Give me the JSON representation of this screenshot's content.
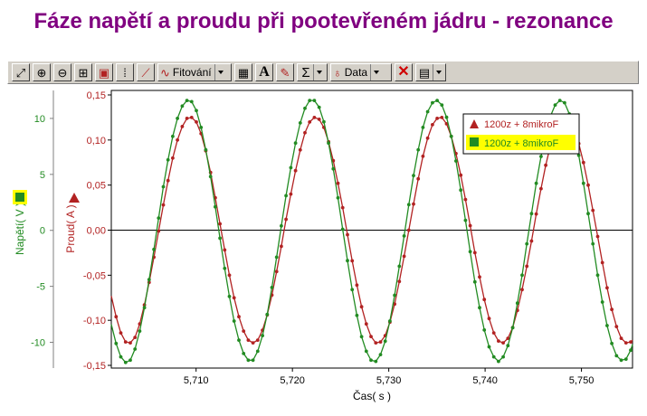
{
  "title": "Fáze napětí a proudu při pootevřeném jádru - rezonance",
  "toolbar": {
    "fit_label": "Fitování",
    "sigma_label": "Σ",
    "data_label": "Data",
    "text_tool_label": "A"
  },
  "colors": {
    "voltage": "#228b22",
    "current": "#b22222",
    "title": "#800080",
    "highlight": "#ffff00"
  },
  "chart_data": {
    "type": "line",
    "xlabel": "Čas( s )",
    "xlim": [
      5.7012,
      5.7553
    ],
    "xticks": [
      5.71,
      5.72,
      5.73,
      5.74,
      5.75
    ],
    "xtick_labels": [
      "5,710",
      "5,720",
      "5,730",
      "5,740",
      "5,750"
    ],
    "y_left": {
      "label": "Napětí( V )",
      "lim": [
        -12.3,
        12.5
      ],
      "ticks": [
        10,
        5,
        0,
        -5,
        -10
      ],
      "tick_labels": [
        "10",
        "5",
        "0",
        "-5",
        "-10"
      ],
      "color": "#228b22"
    },
    "y_right": {
      "label": "Proud( A )",
      "lim": [
        -0.153,
        0.155
      ],
      "ticks": [
        0.15,
        0.1,
        0.05,
        0.0,
        -0.05,
        -0.1,
        -0.15
      ],
      "tick_labels": [
        "0,15",
        "0,10",
        "0,05",
        "0,00",
        "-0,05",
        "-0,10",
        "-0,15"
      ],
      "color": "#b22222"
    },
    "legend": {
      "position": "top-right",
      "entries": [
        "1200z + 8mikroF",
        "1200z + 8mikroF"
      ]
    },
    "series": [
      {
        "name": "1200z + 8mikroF",
        "axis": "right",
        "color": "#b22222",
        "marker": "triangle",
        "x": [
          5.7012,
          5.7017,
          5.70219,
          5.70268,
          5.70317,
          5.70366,
          5.70415,
          5.70464,
          5.70513,
          5.70562,
          5.70611,
          5.7066,
          5.70709,
          5.70758,
          5.70807,
          5.70856,
          5.70905,
          5.70954,
          5.71003,
          5.71052,
          5.71101,
          5.7115,
          5.71199,
          5.71248,
          5.71297,
          5.71346,
          5.71395,
          5.71444,
          5.71493,
          5.71542,
          5.71591,
          5.7164,
          5.71689,
          5.71738,
          5.71787,
          5.71836,
          5.71885,
          5.71934,
          5.71983,
          5.72032,
          5.72081,
          5.7213,
          5.72179,
          5.72228,
          5.72277,
          5.72326,
          5.72375,
          5.72424,
          5.72473,
          5.72522,
          5.72571,
          5.7262,
          5.72669,
          5.72718,
          5.72767,
          5.72816,
          5.72865,
          5.72914,
          5.72963,
          5.73012,
          5.73061,
          5.7311,
          5.73159,
          5.73208,
          5.73257,
          5.73306,
          5.73355,
          5.73404,
          5.73453,
          5.73502,
          5.73551,
          5.736,
          5.73649,
          5.73698,
          5.73747,
          5.73796,
          5.73845,
          5.73894,
          5.73943,
          5.73992,
          5.74041,
          5.7409,
          5.74139,
          5.74188,
          5.74237,
          5.74286,
          5.74335,
          5.74384,
          5.74433,
          5.74482,
          5.74531,
          5.7458,
          5.74629,
          5.74678,
          5.74727,
          5.74776,
          5.74825,
          5.74874,
          5.74923,
          5.74972,
          5.75021,
          5.7507,
          5.75119,
          5.75168,
          5.75217,
          5.75266,
          5.75315,
          5.75364,
          5.75413,
          5.75462,
          5.75511,
          5.7553
        ],
        "y": [
          -0.073,
          -0.096,
          -0.114,
          -0.124,
          -0.125,
          -0.119,
          -0.104,
          -0.083,
          -0.058,
          -0.03,
          -0.001,
          0.028,
          0.055,
          0.08,
          0.1,
          0.115,
          0.124,
          0.125,
          0.12,
          0.107,
          0.088,
          0.064,
          0.036,
          0.007,
          -0.022,
          -0.05,
          -0.075,
          -0.096,
          -0.112,
          -0.122,
          -0.125,
          -0.122,
          -0.111,
          -0.094,
          -0.072,
          -0.046,
          -0.018,
          0.012,
          0.04,
          0.066,
          0.089,
          0.108,
          0.12,
          0.125,
          0.123,
          0.114,
          0.098,
          0.077,
          0.052,
          0.025,
          -0.005,
          -0.034,
          -0.061,
          -0.085,
          -0.104,
          -0.118,
          -0.125,
          -0.124,
          -0.117,
          -0.102,
          -0.082,
          -0.057,
          -0.029,
          0.0,
          0.029,
          0.057,
          0.082,
          0.102,
          0.117,
          0.124,
          0.125,
          0.118,
          0.104,
          0.085,
          0.061,
          0.034,
          0.005,
          -0.025,
          -0.052,
          -0.077,
          -0.098,
          -0.114,
          -0.123,
          -0.125,
          -0.12,
          -0.108,
          -0.089,
          -0.066,
          -0.04,
          -0.012,
          0.018,
          0.046,
          0.072,
          0.094,
          0.111,
          0.122,
          0.125,
          0.122,
          0.112,
          0.096,
          0.075,
          0.05,
          0.022,
          -0.007,
          -0.036,
          -0.064,
          -0.088,
          -0.107,
          -0.12,
          -0.125,
          -0.124,
          -0.122
        ]
      },
      {
        "name": "1200z + 8mikroF",
        "axis": "left",
        "color": "#228b22",
        "marker": "square",
        "x": [
          5.7012,
          5.7017,
          5.70219,
          5.70268,
          5.70317,
          5.70366,
          5.70415,
          5.70464,
          5.70513,
          5.70562,
          5.70611,
          5.7066,
          5.70709,
          5.70758,
          5.70807,
          5.70856,
          5.70905,
          5.70954,
          5.71003,
          5.71052,
          5.71101,
          5.7115,
          5.71199,
          5.71248,
          5.71297,
          5.71346,
          5.71395,
          5.71444,
          5.71493,
          5.71542,
          5.71591,
          5.7164,
          5.71689,
          5.71738,
          5.71787,
          5.71836,
          5.71885,
          5.71934,
          5.71983,
          5.72032,
          5.72081,
          5.7213,
          5.72179,
          5.72228,
          5.72277,
          5.72326,
          5.72375,
          5.72424,
          5.72473,
          5.72522,
          5.72571,
          5.7262,
          5.72669,
          5.72718,
          5.72767,
          5.72816,
          5.72865,
          5.72914,
          5.72963,
          5.73012,
          5.73061,
          5.7311,
          5.73159,
          5.73208,
          5.73257,
          5.73306,
          5.73355,
          5.73404,
          5.73453,
          5.73502,
          5.73551,
          5.736,
          5.73649,
          5.73698,
          5.73747,
          5.73796,
          5.73845,
          5.73894,
          5.73943,
          5.73992,
          5.74041,
          5.7409,
          5.74139,
          5.74188,
          5.74237,
          5.74286,
          5.74335,
          5.74384,
          5.74433,
          5.74482,
          5.74531,
          5.7458,
          5.74629,
          5.74678,
          5.74727,
          5.74776,
          5.74825,
          5.74874,
          5.74923,
          5.74972,
          5.75021,
          5.7507,
          5.75119,
          5.75168,
          5.75217,
          5.75266,
          5.75315,
          5.75364,
          5.75413,
          5.75462,
          5.75511,
          5.7553
        ],
        "y": [
          -8.4,
          -10.1,
          -11.3,
          -11.8,
          -11.6,
          -10.6,
          -9.0,
          -6.9,
          -4.4,
          -1.7,
          1.1,
          3.9,
          6.3,
          8.4,
          10.0,
          11.1,
          11.6,
          11.5,
          10.7,
          9.2,
          7.2,
          4.8,
          2.1,
          -0.7,
          -3.4,
          -5.9,
          -8.1,
          -9.8,
          -11.0,
          -11.6,
          -11.6,
          -10.8,
          -9.4,
          -7.5,
          -5.1,
          -2.4,
          0.4,
          3.1,
          5.6,
          7.8,
          9.6,
          10.9,
          11.6,
          11.6,
          11.0,
          9.7,
          7.8,
          5.5,
          2.9,
          0.1,
          -2.7,
          -5.3,
          -7.6,
          -9.5,
          -10.8,
          -11.6,
          -11.7,
          -11.1,
          -9.9,
          -8.1,
          -5.8,
          -3.2,
          -0.5,
          2.3,
          4.9,
          7.2,
          9.2,
          10.6,
          11.4,
          11.6,
          11.2,
          10.1,
          8.4,
          6.2,
          3.6,
          0.9,
          -1.9,
          -4.6,
          -6.9,
          -8.9,
          -10.4,
          -11.3,
          -11.7,
          -11.3,
          -10.3,
          -8.7,
          -6.5,
          -4.0,
          -1.2,
          1.5,
          4.2,
          6.6,
          8.6,
          10.2,
          11.2,
          11.6,
          11.4,
          10.4,
          8.8,
          6.7,
          4.2,
          1.5,
          -1.2,
          -4.0,
          -6.4,
          -8.5,
          -10.1,
          -11.2,
          -11.6,
          -11.5,
          -10.7,
          -10.2
        ]
      }
    ]
  }
}
